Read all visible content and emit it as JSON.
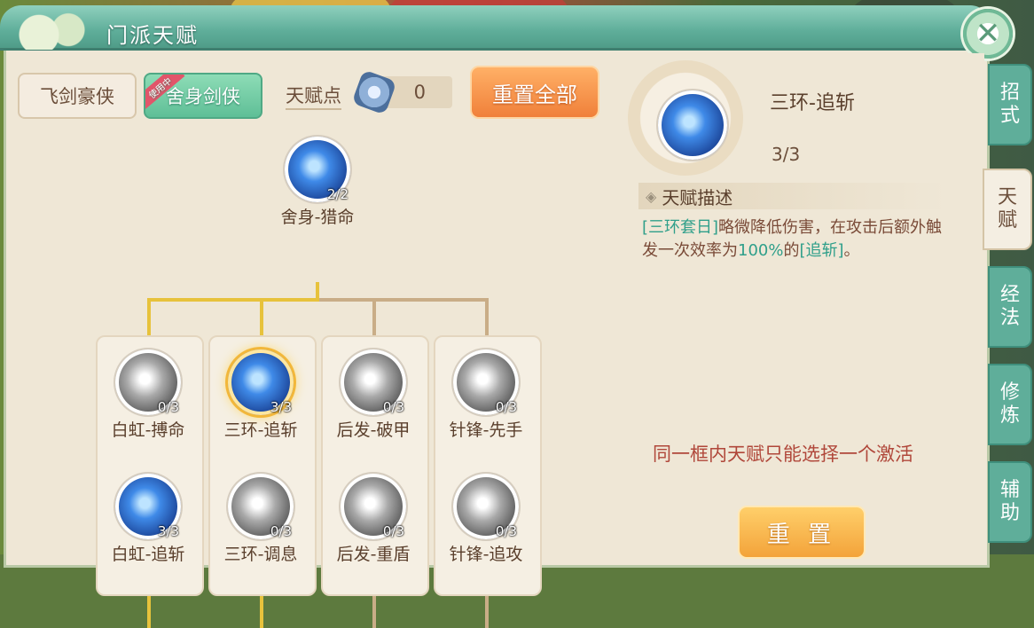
{
  "window": {
    "title": "门派天赋"
  },
  "header": {
    "close_symbol": "✕"
  },
  "schools": {
    "tab1": "飞剑豪侠",
    "tab2": "舍身剑侠",
    "tab2_badge": "使用中"
  },
  "talent_points": {
    "label": "天赋点",
    "value": "0",
    "icon": "crystal-icon"
  },
  "reset_all_label": "重置全部",
  "tree": {
    "root": {
      "name": "舍身-猎命",
      "rank": "2/2",
      "style": "blue"
    },
    "row1": [
      {
        "name": "白虹-搏命",
        "rank": "0/3",
        "style": "gray"
      },
      {
        "name": "三环-追斩",
        "rank": "3/3",
        "style": "blue-selected"
      },
      {
        "name": "后发-破甲",
        "rank": "0/3",
        "style": "gray"
      },
      {
        "name": "针锋-先手",
        "rank": "0/3",
        "style": "gray"
      }
    ],
    "row2": [
      {
        "name": "白虹-追斩",
        "rank": "3/3",
        "style": "blue"
      },
      {
        "name": "三环-调息",
        "rank": "0/3",
        "style": "gray"
      },
      {
        "name": "后发-重盾",
        "rank": "0/3",
        "style": "gray"
      },
      {
        "name": "针锋-追攻",
        "rank": "0/3",
        "style": "gray"
      }
    ]
  },
  "detail": {
    "name": "三环-追斩",
    "rank": "3/3",
    "section_title": "天赋描述",
    "desc_tag": "[三环套日]",
    "desc_part1": "略微降低伤害，在攻击后额外触发一次效率为",
    "desc_pct": "100%",
    "desc_part2": "的",
    "desc_link": "[追斩]",
    "desc_end": "。",
    "note": "同一框内天赋只能选择一个激活",
    "reset_label": "重 置"
  },
  "side_tabs": [
    {
      "label": "招\n式"
    },
    {
      "label": "天\n赋"
    },
    {
      "label": "经\n法"
    },
    {
      "label": "修\n炼"
    },
    {
      "label": "辅\n助"
    }
  ],
  "colors": {
    "accent_teal": "#5fae9a",
    "highlight": "#2f9f8a",
    "note_red": "#b0473a",
    "gold_line": "#e7c23c"
  }
}
